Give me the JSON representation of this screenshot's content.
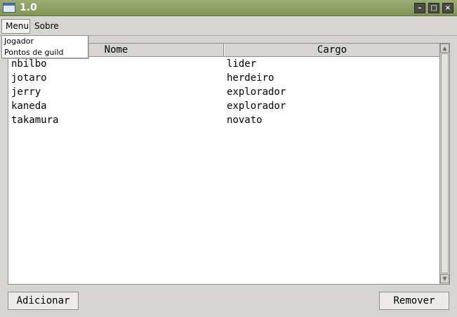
{
  "window": {
    "title": "1.0",
    "controls": {
      "minimize": "–",
      "maximize": "□",
      "close": "×"
    }
  },
  "menubar": {
    "items": [
      {
        "label": "Menu",
        "active": true
      },
      {
        "label": "Sobre",
        "active": false
      }
    ]
  },
  "menu_dropdown": {
    "items": [
      {
        "label": "Jogador"
      },
      {
        "label": "Pontos de guild"
      }
    ]
  },
  "table": {
    "columns": [
      "Nome",
      "Cargo"
    ],
    "rows": [
      {
        "nome": "nbilbo",
        "cargo": "lider"
      },
      {
        "nome": "jotaro",
        "cargo": "herdeiro"
      },
      {
        "nome": "jerry",
        "cargo": "explorador"
      },
      {
        "nome": "kaneda",
        "cargo": "explorador"
      },
      {
        "nome": "takamura",
        "cargo": "novato"
      }
    ]
  },
  "buttons": {
    "add": "Adicionar",
    "remove": "Remover"
  },
  "scrollbar": {
    "up_icon": "▲",
    "down_icon": "▼"
  },
  "colors": {
    "titlebar": "#7f9556",
    "background": "#d6d5d1"
  }
}
